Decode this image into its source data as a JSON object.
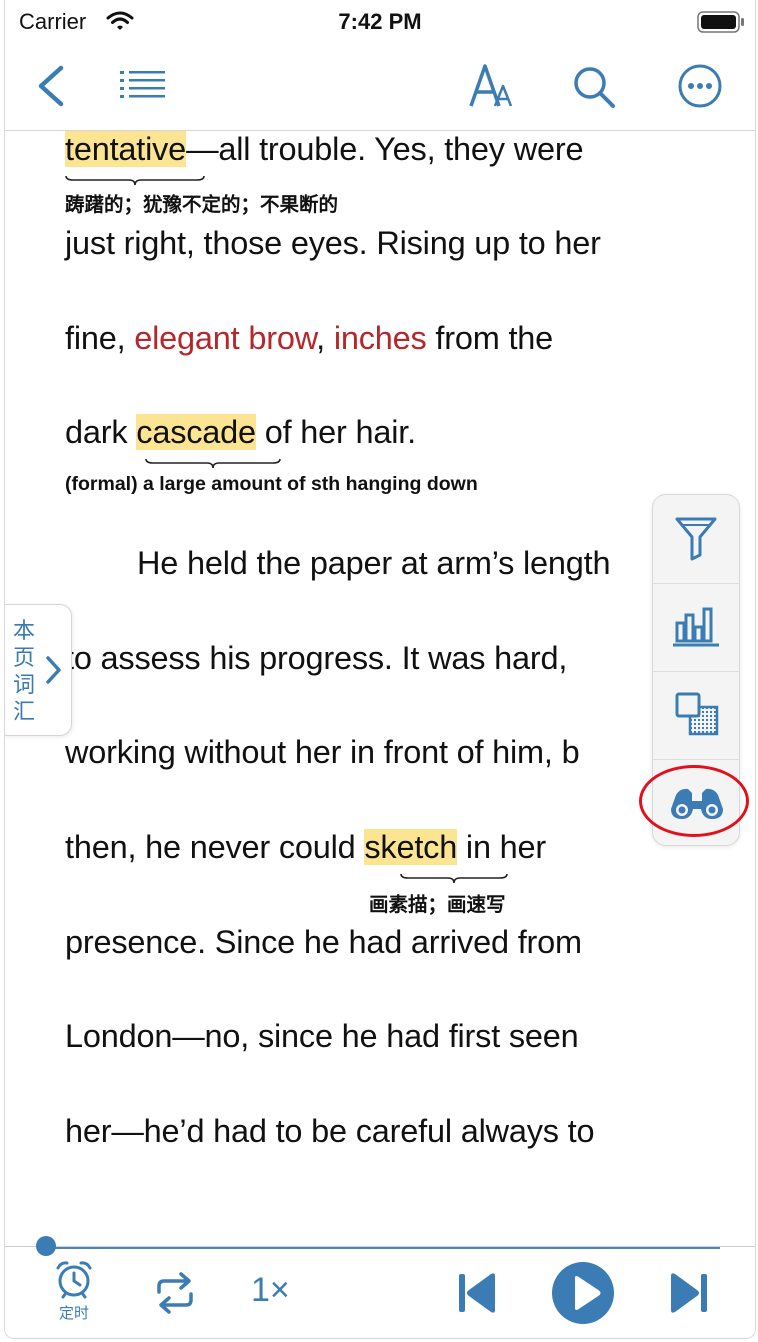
{
  "status_bar": {
    "carrier": "Carrier",
    "time": "7:42 PM"
  },
  "navbar": {
    "icons": [
      "back-chevron-icon",
      "table-of-contents-icon",
      "font-size-icon",
      "search-icon",
      "more-icon"
    ],
    "accent_color": "#3b7cb4"
  },
  "reader": {
    "lines": [
      {
        "pre": "",
        "hl": "tentative",
        "post": "—all trouble. Yes, they were"
      },
      {
        "text": "just right, those eyes. Rising up to her"
      },
      {
        "pre": "fine, ",
        "red1": "elegant brow",
        "mid": ", ",
        "red2": "inches",
        "post": " from the"
      },
      {
        "pre": "dark ",
        "hl": "cascade",
        "post": " of her hair."
      },
      {
        "text": "He held the paper at arm’s length"
      },
      {
        "text": "to assess his progress. It was hard,"
      },
      {
        "text": "working without her in front of him, b"
      },
      {
        "pre": "then, he never could ",
        "hl": "sketch",
        "post": " in her"
      },
      {
        "text": "presence. Since he had arrived from"
      },
      {
        "text": "London—no, since he had first seen"
      },
      {
        "text": "her—he’d had to be careful always to"
      }
    ],
    "glosses": {
      "tentative": "踌躇的；犹豫不定的；不果断的",
      "cascade": "(formal) a large amount of sth hanging down",
      "sketch": "画素描；画速写"
    },
    "highlight_color": "#fbe592",
    "unknown_word_color": "#b5272a"
  },
  "side_tab": {
    "label": "本页词汇"
  },
  "tool_panel": {
    "tools": [
      "filter-icon",
      "stats-chart-icon",
      "copy-overlay-icon",
      "binoculars-icon"
    ],
    "annotated_tool": "binoculars-icon"
  },
  "player": {
    "timer_label": "定时",
    "speed_label": "1×",
    "controls": [
      "repeat-icon",
      "skip-previous-icon",
      "play-icon",
      "skip-next-icon"
    ]
  }
}
